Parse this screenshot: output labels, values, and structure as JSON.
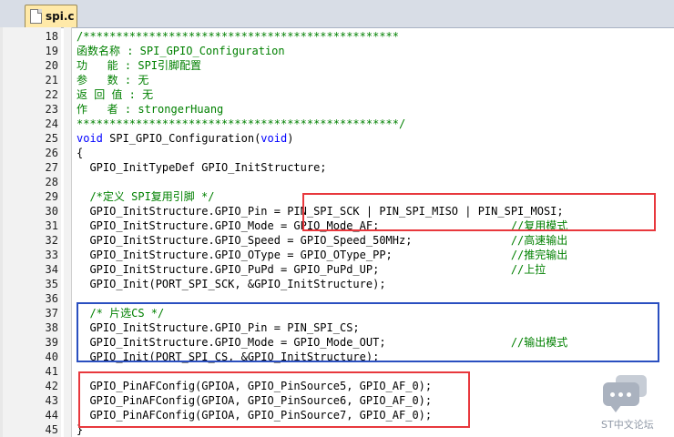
{
  "tab": {
    "label": "spi.c",
    "icon": "c-file-icon"
  },
  "lines": [
    {
      "num": "18",
      "segs": [
        {
          "t": "/************************************************",
          "c": "cmt"
        }
      ]
    },
    {
      "num": "19",
      "segs": [
        {
          "t": "函数名称 : SPI_GPIO_Configuration",
          "c": "cmt"
        }
      ]
    },
    {
      "num": "20",
      "segs": [
        {
          "t": "功   能 : SPI引脚配置",
          "c": "cmt"
        }
      ]
    },
    {
      "num": "21",
      "segs": [
        {
          "t": "参   数 : 无",
          "c": "cmt"
        }
      ]
    },
    {
      "num": "22",
      "segs": [
        {
          "t": "返 回 值 : 无",
          "c": "cmt"
        }
      ]
    },
    {
      "num": "23",
      "segs": [
        {
          "t": "作   者 : strongerHuang",
          "c": "cmt"
        }
      ]
    },
    {
      "num": "24",
      "segs": [
        {
          "t": "*************************************************/",
          "c": "cmt"
        }
      ]
    },
    {
      "num": "25",
      "segs": [
        {
          "t": "void",
          "c": "kw"
        },
        {
          "t": " SPI_GPIO_Configuration(",
          "c": ""
        },
        {
          "t": "void",
          "c": "kw"
        },
        {
          "t": ")",
          "c": ""
        }
      ]
    },
    {
      "num": "26",
      "segs": [
        {
          "t": "{",
          "c": ""
        }
      ]
    },
    {
      "num": "27",
      "segs": [
        {
          "t": "  GPIO_InitTypeDef GPIO_InitStructure;",
          "c": ""
        }
      ]
    },
    {
      "num": "28",
      "segs": []
    },
    {
      "num": "29",
      "segs": [
        {
          "t": "  /*定义 SPI复用引脚 */",
          "c": "cmt"
        }
      ]
    },
    {
      "num": "30",
      "segs": [
        {
          "t": "  GPIO_InitStructure.GPIO_Pin = PIN_SPI_SCK | PIN_SPI_MISO | PIN_SPI_MOSI;",
          "c": ""
        }
      ]
    },
    {
      "num": "31",
      "segs": [
        {
          "t": "  GPIO_InitStructure.GPIO_Mode = GPIO_Mode_AF;                    ",
          "c": ""
        },
        {
          "t": "//复用模式",
          "c": "cmt"
        }
      ]
    },
    {
      "num": "32",
      "segs": [
        {
          "t": "  GPIO_InitStructure.GPIO_Speed = GPIO_Speed_50MHz;               ",
          "c": ""
        },
        {
          "t": "//高速输出",
          "c": "cmt"
        }
      ]
    },
    {
      "num": "33",
      "segs": [
        {
          "t": "  GPIO_InitStructure.GPIO_OType = GPIO_OType_PP;                  ",
          "c": ""
        },
        {
          "t": "//推完输出",
          "c": "cmt"
        }
      ]
    },
    {
      "num": "34",
      "segs": [
        {
          "t": "  GPIO_InitStructure.GPIO_PuPd = GPIO_PuPd_UP;                    ",
          "c": ""
        },
        {
          "t": "//上拉",
          "c": "cmt"
        }
      ]
    },
    {
      "num": "35",
      "segs": [
        {
          "t": "  GPIO_Init(PORT_SPI_SCK, &GPIO_InitStructure);",
          "c": ""
        }
      ]
    },
    {
      "num": "36",
      "segs": []
    },
    {
      "num": "37",
      "segs": [
        {
          "t": "  /* 片选CS */",
          "c": "cmt"
        }
      ]
    },
    {
      "num": "38",
      "segs": [
        {
          "t": "  GPIO_InitStructure.GPIO_Pin = PIN_SPI_CS;",
          "c": ""
        }
      ]
    },
    {
      "num": "39",
      "segs": [
        {
          "t": "  GPIO_InitStructure.GPIO_Mode = GPIO_Mode_OUT;                   ",
          "c": ""
        },
        {
          "t": "//输出模式",
          "c": "cmt"
        }
      ]
    },
    {
      "num": "40",
      "segs": [
        {
          "t": "  GPIO_Init(PORT_SPI_CS, &GPIO_InitStructure);",
          "c": ""
        }
      ]
    },
    {
      "num": "41",
      "segs": []
    },
    {
      "num": "42",
      "segs": [
        {
          "t": "  GPIO_PinAFConfig(GPIOA, GPIO_PinSource5, GPIO_AF_0);",
          "c": ""
        }
      ]
    },
    {
      "num": "43",
      "segs": [
        {
          "t": "  GPIO_PinAFConfig(GPIOA, GPIO_PinSource6, GPIO_AF_0);",
          "c": ""
        }
      ]
    },
    {
      "num": "44",
      "segs": [
        {
          "t": "  GPIO_PinAFConfig(GPIOA, GPIO_PinSource7, GPIO_AF_0);",
          "c": ""
        }
      ]
    },
    {
      "num": "45",
      "segs": [
        {
          "t": "}",
          "c": ""
        }
      ]
    }
  ],
  "highlights": [
    {
      "name": "highlight-box-spi-pins",
      "color": "#e8383d"
    },
    {
      "name": "highlight-box-cs-config",
      "color": "#2a4fc0"
    },
    {
      "name": "highlight-box-af-config",
      "color": "#e8383d"
    }
  ],
  "watermark": {
    "text": "ST中文论坛",
    "icon": "chat-bubble-icon"
  }
}
